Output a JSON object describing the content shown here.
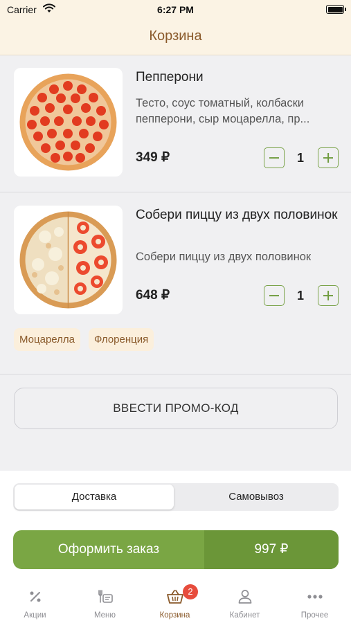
{
  "status_bar": {
    "carrier": "Carrier",
    "time": "6:27 PM"
  },
  "header": {
    "title": "Корзина"
  },
  "cart": {
    "items": [
      {
        "name": "Пепперони",
        "description": "Тесто, соус томатный, колбаски пепперони, сыр моцарелла, пр...",
        "price": "349 ₽",
        "quantity": "1"
      },
      {
        "name": "Собери пиццу из двух половинок",
        "description": "Собери пиццу из двух половинок",
        "price": "648 ₽",
        "quantity": "1",
        "toppings": [
          "Моцарелла",
          "Флоренция"
        ]
      }
    ]
  },
  "promo": {
    "label": "ВВЕСТИ ПРОМО-КОД"
  },
  "delivery_options": {
    "selected": "Доставка",
    "delivery": "Доставка",
    "pickup": "Самовывоз"
  },
  "checkout": {
    "label": "Оформить заказ",
    "total": "997 ₽"
  },
  "tabbar": {
    "items": [
      {
        "label": "Акции",
        "icon": "percent-icon"
      },
      {
        "label": "Меню",
        "icon": "menu-food-icon"
      },
      {
        "label": "Корзина",
        "icon": "basket-icon",
        "badge": "2"
      },
      {
        "label": "Кабинет",
        "icon": "person-icon"
      },
      {
        "label": "Прочее",
        "icon": "more-dots-icon"
      }
    ]
  },
  "colors": {
    "accent_green": "#7aa644",
    "accent_brown": "#8a5a2b",
    "header_bg": "#fbf3e4",
    "badge_red": "#e74c3c"
  }
}
